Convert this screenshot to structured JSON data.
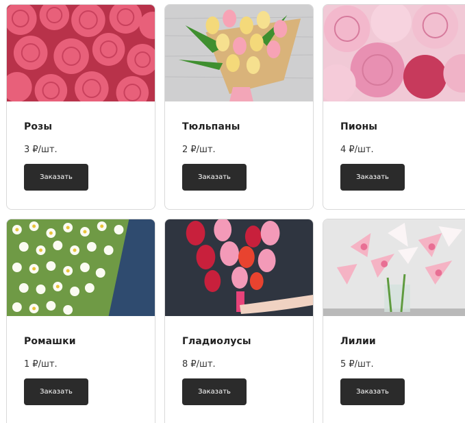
{
  "products": [
    {
      "name": "Розы",
      "price": "3 ₽/шт.",
      "button": "Заказать",
      "image": "roses-photo"
    },
    {
      "name": "Тюльпаны",
      "price": "2 ₽/шт.",
      "button": "Заказать",
      "image": "tulips-photo"
    },
    {
      "name": "Пионы",
      "price": "4 ₽/шт.",
      "button": "Заказать",
      "image": "peonies-photo"
    },
    {
      "name": "Ромашки",
      "price": "1 ₽/шт.",
      "button": "Заказать",
      "image": "daisies-photo"
    },
    {
      "name": "Гладиолусы",
      "price": "8 ₽/шт.",
      "button": "Заказать",
      "image": "gladioli-photo"
    },
    {
      "name": "Лилии",
      "price": "5 ₽/шт.",
      "button": "Заказать",
      "image": "lilies-photo"
    }
  ],
  "colors": {
    "button_bg": "#2b2b2b",
    "button_text": "#ffffff",
    "card_border": "#d9d9d9"
  }
}
